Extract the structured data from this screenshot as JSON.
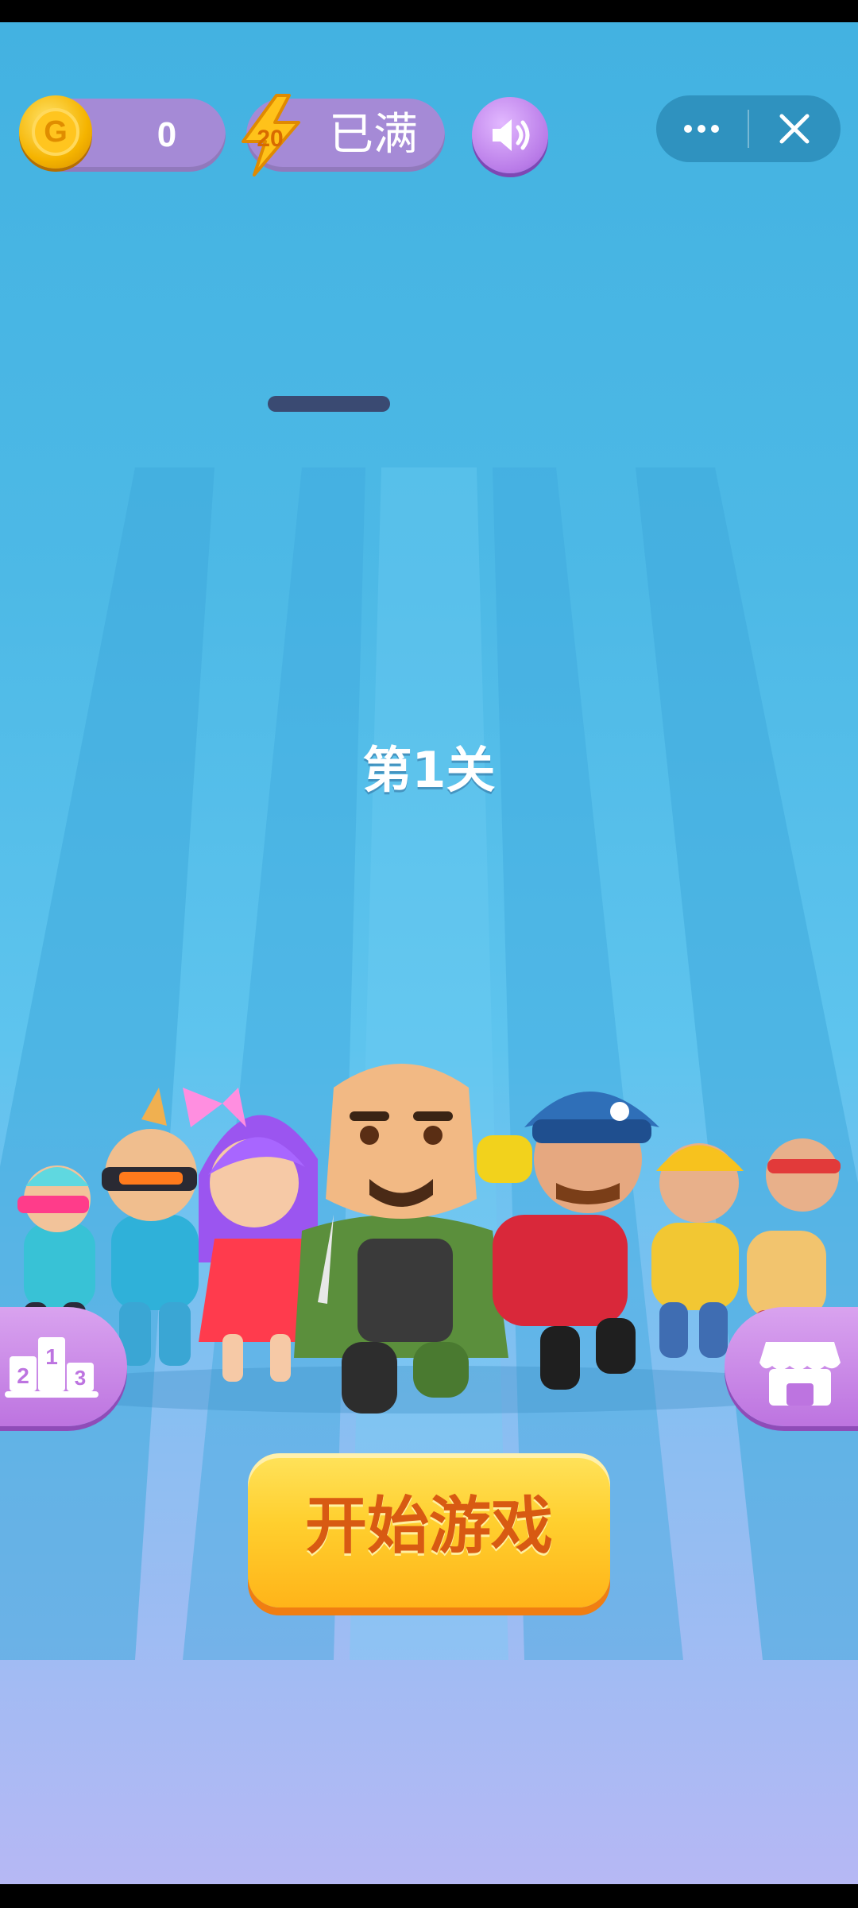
{
  "hud": {
    "coin_value": "0",
    "energy_badge": "20",
    "energy_status": "已满",
    "coin_symbol": "G"
  },
  "level": {
    "title": "第1关"
  },
  "start_button": {
    "label": "开始游戏"
  },
  "leaderboard_icon_digits": [
    "2",
    "1",
    "3"
  ],
  "colors": {
    "sky_top": "#43b2e1",
    "sky_bottom": "#b6b8f4",
    "pill": "#a58ad6",
    "accent_purple": "#bd74e0",
    "button_yellow": "#ffcf2e",
    "button_text": "#d85a12"
  },
  "icons": [
    "coin-icon",
    "lightning-icon",
    "speaker-icon",
    "more-icon",
    "close-icon",
    "leaderboard-podium-icon",
    "shop-store-icon"
  ]
}
